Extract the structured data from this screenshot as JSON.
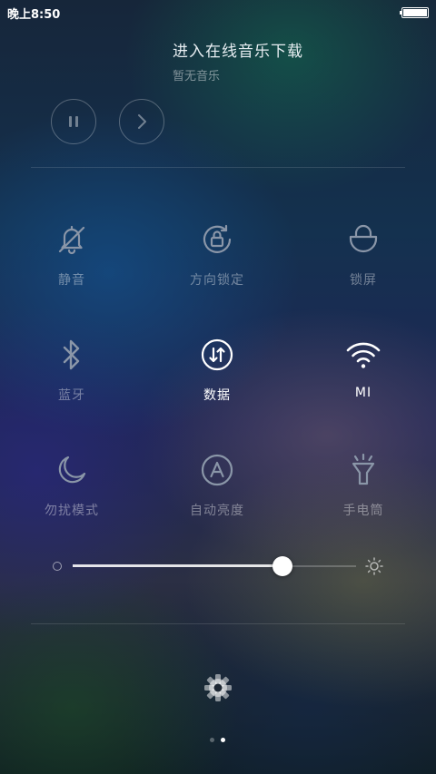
{
  "status_bar": {
    "time": "晚上8:50",
    "battery_level": 1.0
  },
  "music": {
    "title": "进入在线音乐下载",
    "subtitle": "暂无音乐"
  },
  "media_controls": [
    {
      "icon": "pause-icon"
    },
    {
      "icon": "next-icon"
    }
  ],
  "toggles": [
    {
      "id": "mute",
      "label": "静音",
      "icon": "bell-off-icon",
      "active": false
    },
    {
      "id": "rotation-lock",
      "label": "方向锁定",
      "icon": "rotation-lock-icon",
      "active": false
    },
    {
      "id": "lock-screen",
      "label": "锁屏",
      "icon": "lock-icon",
      "active": false
    },
    {
      "id": "bluetooth",
      "label": "蓝牙",
      "icon": "bluetooth-icon",
      "active": false
    },
    {
      "id": "data",
      "label": "数据",
      "icon": "mobile-data-icon",
      "active": true
    },
    {
      "id": "wifi",
      "label": "MI",
      "icon": "wifi-icon",
      "active": true
    },
    {
      "id": "dnd",
      "label": "勿扰模式",
      "icon": "moon-icon",
      "active": false
    },
    {
      "id": "auto-brightness",
      "label": "自动亮度",
      "icon": "auto-brightness-icon",
      "active": false
    },
    {
      "id": "flashlight",
      "label": "手电筒",
      "icon": "flashlight-icon",
      "active": false
    }
  ],
  "brightness": {
    "value_fraction": 0.74
  },
  "page_indicator": {
    "total": 2,
    "current": 2
  },
  "colors": {
    "inactive": "#8a96a8",
    "active": "#ffffff"
  }
}
